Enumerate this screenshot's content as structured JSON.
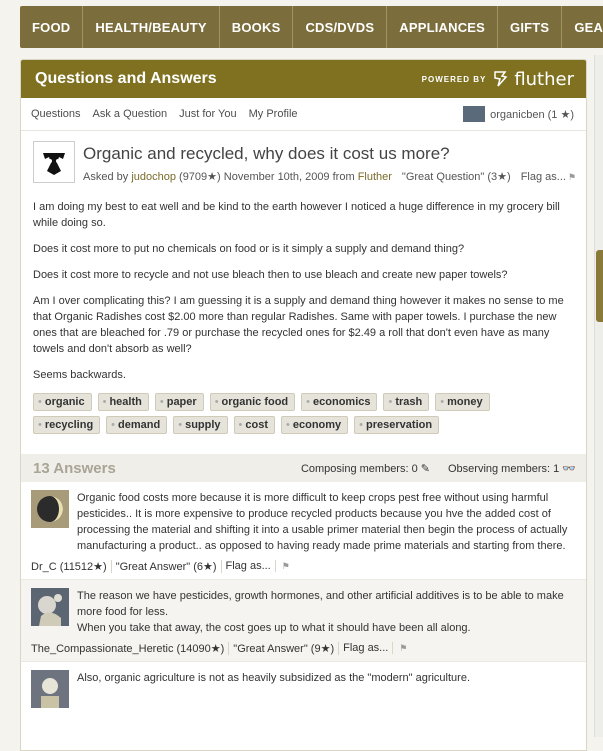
{
  "top_nav": [
    "FOOD",
    "HEALTH/BEAUTY",
    "BOOKS",
    "CDS/DVDS",
    "APPLIANCES",
    "GIFTS",
    "GEAR"
  ],
  "panel": {
    "title": "Questions and Answers",
    "powered_by": "POWERED BY",
    "brand": "fluther"
  },
  "subnav": {
    "links": [
      "Questions",
      "Ask a Question",
      "Just for You",
      "My Profile"
    ],
    "user": "organicben (1 ★)"
  },
  "question": {
    "title": "Organic and recycled, why does it cost us more?",
    "asked_by_prefix": "Asked by",
    "author": "judochop",
    "author_score": "(9709★)",
    "date": "November 10th, 2009 from",
    "source": "Fluther",
    "great_question": "\"Great Question\" (3★)",
    "flag": "Flag as...",
    "paragraphs": [
      "I am doing my best to eat well and be kind to the earth however I noticed a huge difference in my grocery bill while doing so.",
      "Does it cost more to put no chemicals on food or is it simply a supply and demand thing?",
      "Does it cost more to recycle and not use bleach then to use bleach and create new paper towels?",
      "Am I over complicating this? I am guessing it is a supply and demand thing however it makes no sense to me that Organic Radishes cost $2.00 more than regular Radishes. Same with paper towels. I purchase the new ones that are bleached for .79 or purchase the recycled ones for $2.49 a roll that don't even have as many towels and don't absorb as well?",
      "Seems backwards."
    ],
    "tags": [
      "organic",
      "health",
      "paper",
      "organic food",
      "economics",
      "trash",
      "money",
      "recycling",
      "demand",
      "supply",
      "cost",
      "economy",
      "preservation"
    ]
  },
  "answers_header": {
    "count": "13 Answers",
    "composing": "Composing members: 0 ✎",
    "observing": "Observing members: 1 👓"
  },
  "answers": [
    {
      "text": [
        "Organic food costs more because it is more difficult to keep crops pest free without using harmful pesticides.. It is more expensive to produce recycled products because you hve the added cost of processing the material and shifting it into a usable primer material then begin the process of actually manufacturing a product.. as opposed to having ready made prime materials and starting from there."
      ],
      "user": "Dr_C (11512★)",
      "great": "\"Great Answer\" (6★)",
      "flag": "Flag as..."
    },
    {
      "text": [
        "The reason we have pesticides, growth hormones, and other artificial additives is to be able to make more food for less.",
        "When you take that away, the cost goes up to what it should have been all along."
      ],
      "user": "The_Compassionate_Heretic (14090★)",
      "great": "\"Great Answer\" (9★)",
      "flag": "Flag as..."
    },
    {
      "text": [
        "Also, organic agriculture is not as heavily subsidized as the \"modern\" agriculture."
      ]
    }
  ]
}
